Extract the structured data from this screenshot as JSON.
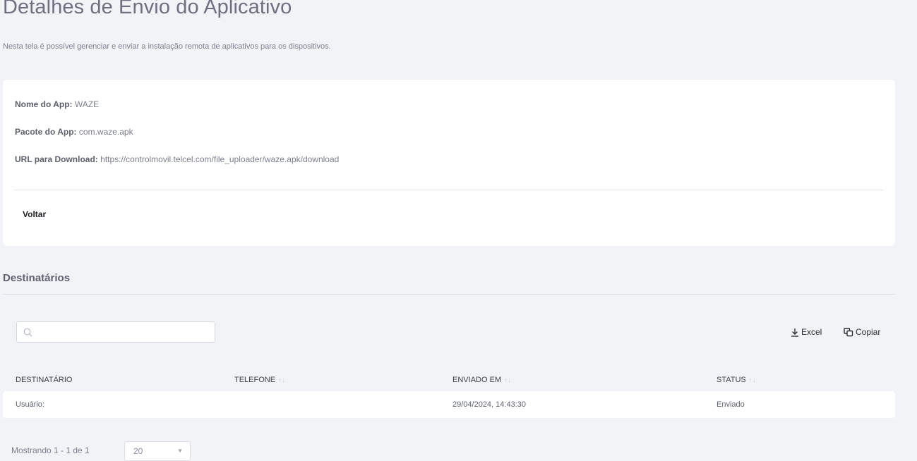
{
  "header": {
    "title": "Detalhes de Envio do Aplicativo",
    "subtitle": "Nesta tela é possível gerenciar e enviar a instalação remota de aplicativos para os dispositivos."
  },
  "details": {
    "app_name_label": "Nome do App:",
    "app_name": "WAZE",
    "package_label": "Pacote do App:",
    "package": "com.waze.apk",
    "url_label": "URL para Download:",
    "url": "https://controlmovil.telcel.com/file_uploader/waze.apk/download",
    "back_label": "Voltar"
  },
  "recipients": {
    "title": "Destinatários",
    "search": {
      "value": "",
      "placeholder": ""
    },
    "excel_label": "Excel",
    "copy_label": "Copiar",
    "columns": [
      "DESTINATÁRIO",
      "TELEFONE",
      "ENVIADO EM",
      "STATUS"
    ],
    "sortable": [
      false,
      true,
      true,
      true
    ],
    "rows": [
      [
        "Usuário:",
        "",
        "29/04/2024, 14:43:30",
        "Enviado"
      ]
    ],
    "paging_info": "Mostrando 1 - 1 de 1",
    "page_size": "20"
  }
}
